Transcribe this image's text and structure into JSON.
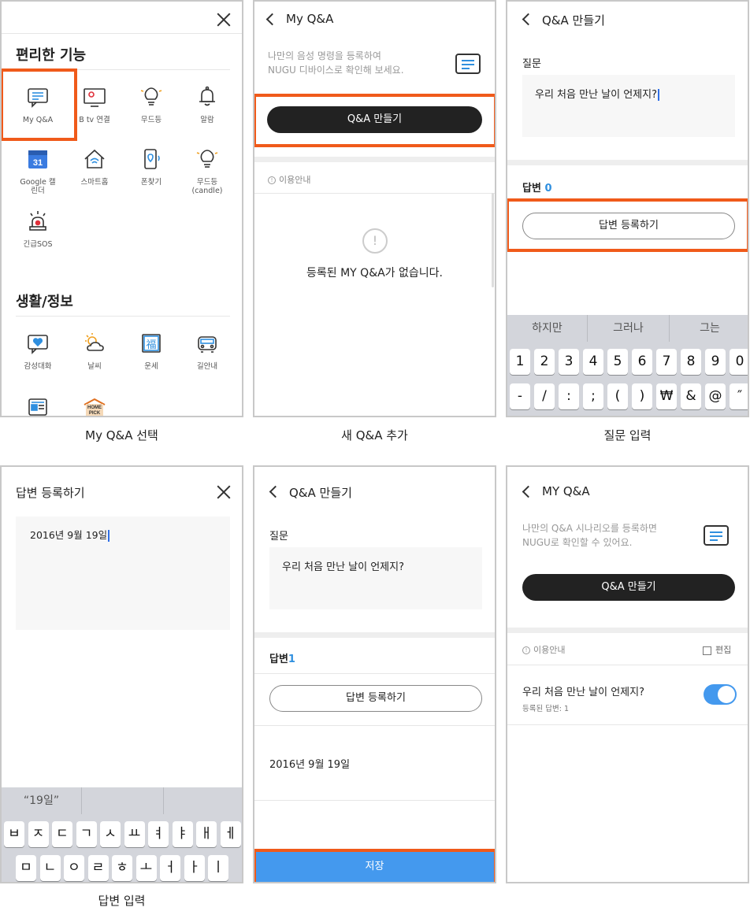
{
  "captions": {
    "c1": "My Q&A 선택",
    "c2": "새 Q&A 추가",
    "c3": "질문 입력",
    "c4": "답변 입력"
  },
  "colors": {
    "accent": "#f05a1a",
    "blue": "#4499ee",
    "dark": "#222222"
  },
  "panel1": {
    "section1": "편리한 기능",
    "section2": "생활/정보",
    "items": [
      {
        "label": "My Q&A",
        "icon": "chat-icon"
      },
      {
        "label": "B tv 연결",
        "icon": "tv-icon"
      },
      {
        "label": "무드등",
        "icon": "bulb-icon"
      },
      {
        "label": "알람",
        "icon": "bell-icon"
      },
      {
        "label": "Google 캘\n린더",
        "icon": "calendar-icon",
        "badge": "31"
      },
      {
        "label": "스마트홈",
        "icon": "home-icon"
      },
      {
        "label": "폰찾기",
        "icon": "phone-icon"
      },
      {
        "label": "무드등\n(candle)",
        "icon": "bulb-icon"
      },
      {
        "label": "긴급SOS",
        "icon": "siren-icon"
      }
    ],
    "items2": [
      {
        "label": "감성대화",
        "icon": "heart-chat-icon"
      },
      {
        "label": "날씨",
        "icon": "weather-icon"
      },
      {
        "label": "운세",
        "icon": "fortune-icon",
        "glyph": "福"
      },
      {
        "label": "길안내",
        "icon": "car-icon"
      },
      {
        "label": "",
        "icon": "news-icon"
      },
      {
        "label": "",
        "icon": "homepick-icon",
        "logo": "HOME PICK"
      }
    ]
  },
  "panel2": {
    "title": "My Q&A",
    "desc": "나만의 음성 명령을 등록하여\nNUGU 디바이스로 확인해 보세요.",
    "button": "Q&A 만들기",
    "info": "이용안내",
    "empty_mark": "!",
    "empty": "등록된 MY Q&A가 없습니다."
  },
  "panel3": {
    "title": "Q&A 만들기",
    "question_label": "질문",
    "question": "우리 처음 만난 날이 언제지?",
    "answer_label": "답변",
    "answer_count": "0",
    "button": "답변 등록하기",
    "suggestions": [
      "하지만",
      "그러나",
      "그는"
    ],
    "row1": [
      "1",
      "2",
      "3",
      "4",
      "5",
      "6",
      "7",
      "8",
      "9",
      "0"
    ],
    "row2": [
      "-",
      "/",
      ":",
      ";",
      "(",
      ")",
      "₩",
      "&",
      "@",
      "″"
    ]
  },
  "panel4": {
    "title": "답변 등록하기",
    "answer": "2016년 9월 19일",
    "suggestion": "“19일”",
    "row1": [
      "ㅂ",
      "ㅈ",
      "ㄷ",
      "ㄱ",
      "ㅅ",
      "ㅛ",
      "ㅕ",
      "ㅑ",
      "ㅐ",
      "ㅔ"
    ],
    "row2": [
      "ㅁ",
      "ㄴ",
      "ㅇ",
      "ㄹ",
      "ㅎ",
      "ㅗ",
      "ㅓ",
      "ㅏ",
      "ㅣ"
    ]
  },
  "panel5": {
    "title": "Q&A 만들기",
    "question_label": "질문",
    "question": "우리 처음 만난 날이 언제지?",
    "answer_label": "답변",
    "answer_count": "1",
    "button": "답변 등록하기",
    "answer": "2016년 9월 19일",
    "save": "저장"
  },
  "panel6": {
    "title": "MY Q&A",
    "desc": "나만의 Q&A 시나리오를 등록하면\nNUGU로 확인할 수 있어요.",
    "button": "Q&A 만들기",
    "info": "이용안내",
    "edit": "편집",
    "item_title": "우리 처음 만난 날이 언제지?",
    "item_sub": "등록된 답변: 1",
    "toggle_on": true
  }
}
